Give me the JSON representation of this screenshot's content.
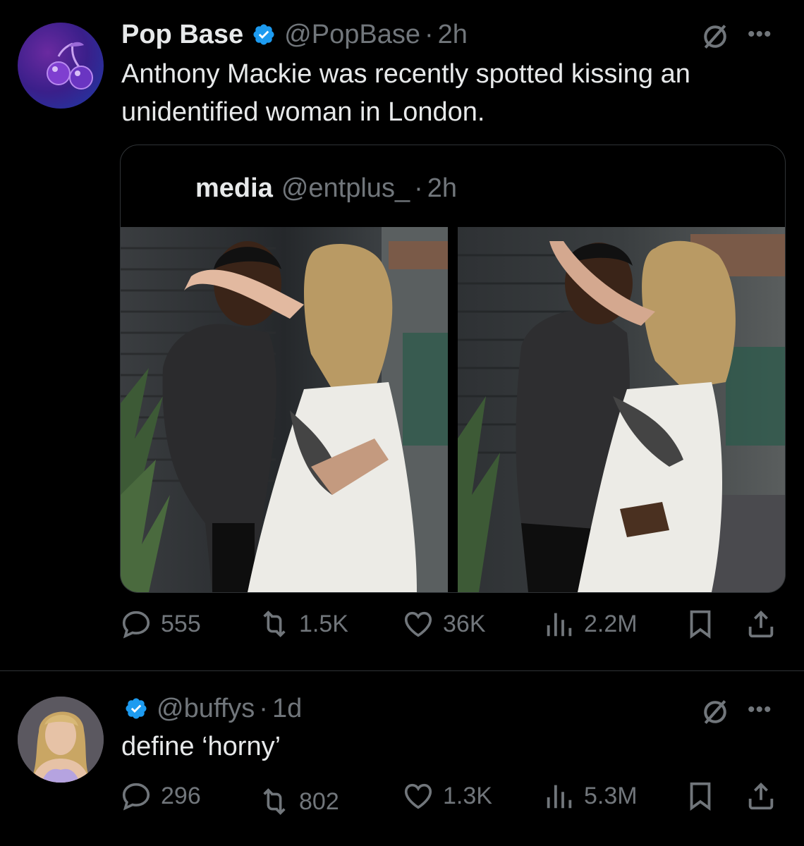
{
  "tweet1": {
    "display_name": "Pop Base",
    "handle": "@PopBase",
    "separator": "·",
    "time": "2h",
    "avatar_icon": "cherry-icon",
    "text_line1": "Anthony Mackie was recently spotted kissing an",
    "text_line2": "unidentified woman in London.",
    "quote": {
      "display_name": "media",
      "handle": "@entplus_",
      "separator": "·",
      "time": "2h"
    },
    "stats": {
      "replies": "555",
      "reposts": "1.5K",
      "likes": "36K",
      "views": "2.2M"
    }
  },
  "tweet2": {
    "handle": "@buffys",
    "separator": "·",
    "time": "1d",
    "text": "define ‘horny’",
    "stats": {
      "replies": "296",
      "reposts": "802",
      "likes": "1.3K",
      "views": "5.3M"
    }
  },
  "colors": {
    "background": "#000000",
    "text": "#e7e9ea",
    "muted": "#71767b",
    "verified": "#1d9bf0",
    "border": "#2f3336"
  }
}
